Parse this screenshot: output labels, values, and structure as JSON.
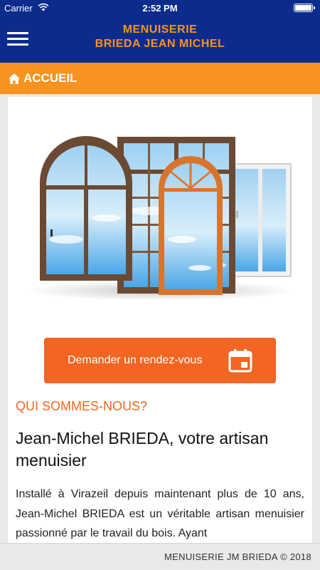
{
  "status_bar": {
    "carrier": "Carrier",
    "time": "2:52 PM"
  },
  "header": {
    "brand_line1": "MENUISERIE",
    "brand_line2": "BRIEDA JEAN MICHEL"
  },
  "breadcrumb": {
    "label": "ACCUEIL"
  },
  "cta": {
    "label": "Demander un rendez-vous"
  },
  "about": {
    "section_title": "QUI SOMMES-NOUS?",
    "headline": "Jean-Michel BRIEDA, votre artisan menuisier",
    "body": "Installé à Virazeil depuis maintenant plus de 10 ans, Jean-Michel BRIEDA est un véritable artisan menuisier passionné par le travail du bois. Ayant"
  },
  "footer": {
    "text": "MENUISERIE JM BRIEDA © 2018"
  },
  "colors": {
    "header_bg": "#0b2c8c",
    "accent_orange": "#f7931e",
    "cta_orange": "#f26522"
  },
  "icons": {
    "menu": "hamburger-icon",
    "home": "home-icon",
    "calendar": "calendar-icon",
    "wifi": "wifi-icon",
    "battery": "battery-icon"
  }
}
